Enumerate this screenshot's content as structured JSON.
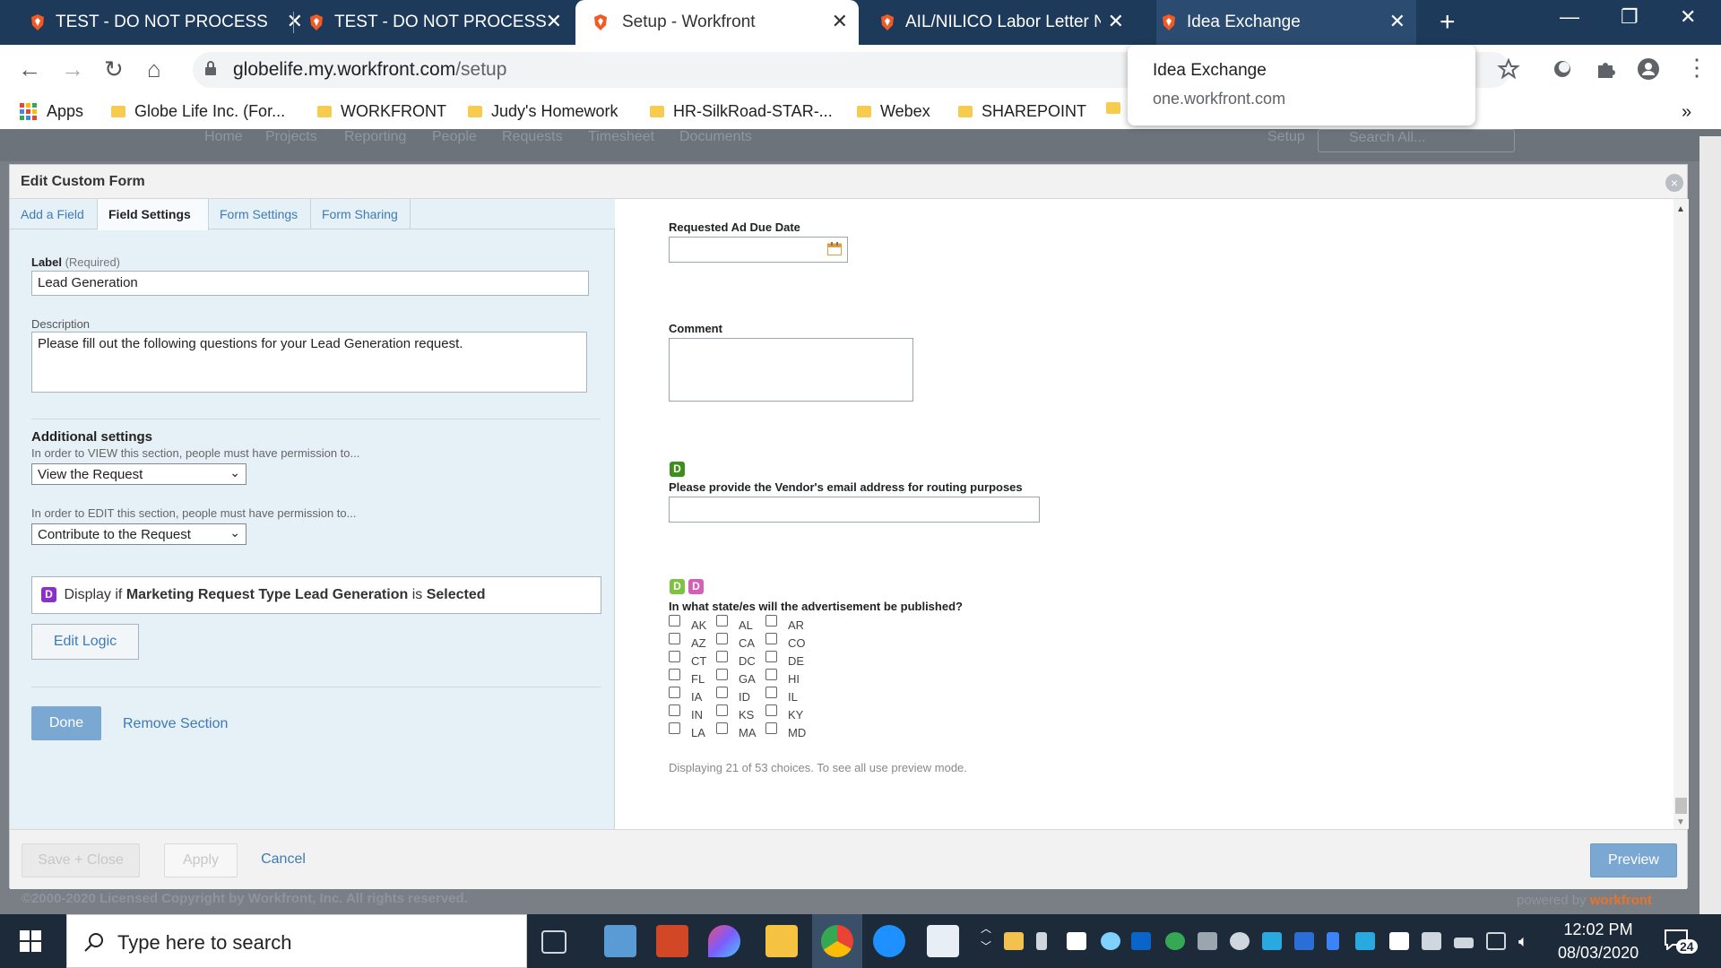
{
  "browser": {
    "tabs": [
      {
        "title": "TEST - DO NOT PROCESS"
      },
      {
        "title": "TEST - DO NOT PROCESS"
      },
      {
        "title": "Setup - Workfront"
      },
      {
        "title": "AIL/NILICO Labor Letter Ne"
      },
      {
        "title": "Idea Exchange"
      }
    ],
    "url_host": "globelife.my.workfront.com",
    "url_path": "/setup",
    "bookmarks": [
      "Apps",
      "Globe Life Inc. (For...",
      "WORKFRONT",
      "Judy's Homework",
      "HR-SilkRoad-STAR-...",
      "Webex",
      "SHAREPOINT"
    ],
    "bookmarks_more": "»"
  },
  "tooltip": {
    "title": "Idea Exchange",
    "domain": "one.workfront.com"
  },
  "modal": {
    "title": "Edit Custom Form",
    "close_symbol": "×",
    "tabs": [
      "Add a Field",
      "Field Settings",
      "Form Settings",
      "Form Sharing"
    ],
    "active_tab": "Field Settings",
    "label_caption": "Label",
    "label_required": "(Required)",
    "label_value": "Lead Generation",
    "description_caption": "Description",
    "description_value": "Please fill out the following questions for your Lead Generation request.",
    "additional_heading": "Additional settings",
    "view_hint": "In order to VIEW this section, people must have permission to...",
    "view_value": "View the Request",
    "edit_hint": "In order to EDIT this section, people must have permission to...",
    "edit_value": "Contribute to the Request",
    "logic": {
      "badge": "D",
      "prefix": "Display if",
      "field": "Marketing Request Type Lead Generation",
      "middle": "is",
      "value": "Selected"
    },
    "edit_logic_label": "Edit Logic",
    "done_label": "Done",
    "remove_label": "Remove Section",
    "preview": {
      "due_date_label": "Requested Ad Due Date",
      "comment_label": "Comment",
      "vendor_badge": "D",
      "vendor_label": "Please provide the Vendor's email address for routing purposes",
      "states_badges": [
        "D",
        "D"
      ],
      "states_label": "In what state/es will the advertisement be published?",
      "states": [
        "AK",
        "AL",
        "AR",
        "AZ",
        "CA",
        "CO",
        "CT",
        "DC",
        "DE",
        "FL",
        "GA",
        "HI",
        "IA",
        "ID",
        "IL",
        "IN",
        "KS",
        "KY",
        "LA",
        "MA",
        "MD"
      ],
      "choices_note": "Displaying 21 of 53 choices. To see all use preview mode."
    },
    "footer": {
      "save_close": "Save + Close",
      "apply": "Apply",
      "cancel": "Cancel",
      "preview": "Preview"
    }
  },
  "workfront_bg": {
    "nav": [
      "Home",
      "Projects",
      "Reporting",
      "People",
      "Requests",
      "Timesheet",
      "Documents"
    ],
    "setup": "Setup",
    "search_placeholder": "Search All...",
    "copyright": "©2000-2020 Licensed Copyright by Workfront, Inc. All rights reserved.",
    "powered_by": "powered by",
    "brand": "workfront"
  },
  "taskbar": {
    "search_placeholder": "Type here to search",
    "time": "12:02 PM",
    "date": "08/03/2020",
    "notifications": "24"
  },
  "colors": {
    "tabstrip": "#1e3a5a",
    "accent_link": "#3d7bb5",
    "button_primary": "#7ba7d3",
    "badge_purple": "#8b2fc9",
    "badge_green_dark": "#3e8e1e",
    "badge_green_light": "#7dc242",
    "badge_pink": "#d35fb7"
  }
}
